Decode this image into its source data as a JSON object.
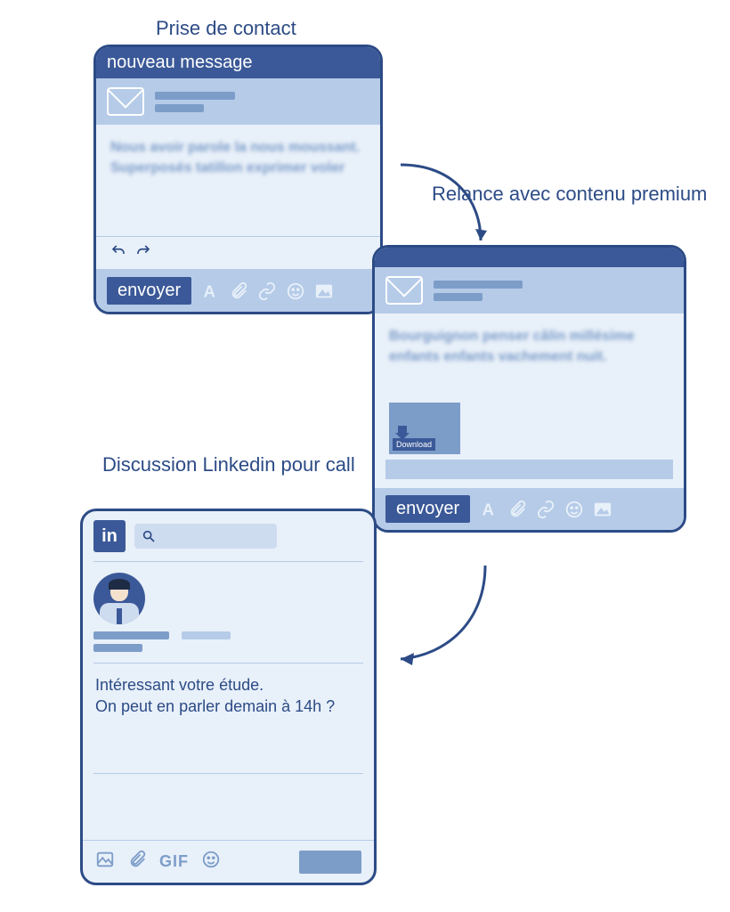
{
  "steps": {
    "step1": {
      "caption": "Prise de contact",
      "title": "nouveau message",
      "blur_body": "Nous avoir parole la nous moussant. Superposés tatillon exprimer voler",
      "send_label": "envoyer"
    },
    "step2": {
      "caption": "Relance avec contenu premium",
      "blur_body": "Bourguignon penser câlin millésime enfants enfants vachement nuit.",
      "download_label": "Download",
      "send_label": "envoyer"
    },
    "step3": {
      "caption": "Discussion Linkedin pour call",
      "logo_text": "in",
      "message_line1": "Intéressant votre étude.",
      "message_line2": "On peut en parler demain à 14h ?",
      "gif_label": "GIF"
    }
  },
  "icons": {
    "font": "A",
    "attach": "paperclip",
    "link": "link",
    "emoji": "smile",
    "image": "image"
  }
}
